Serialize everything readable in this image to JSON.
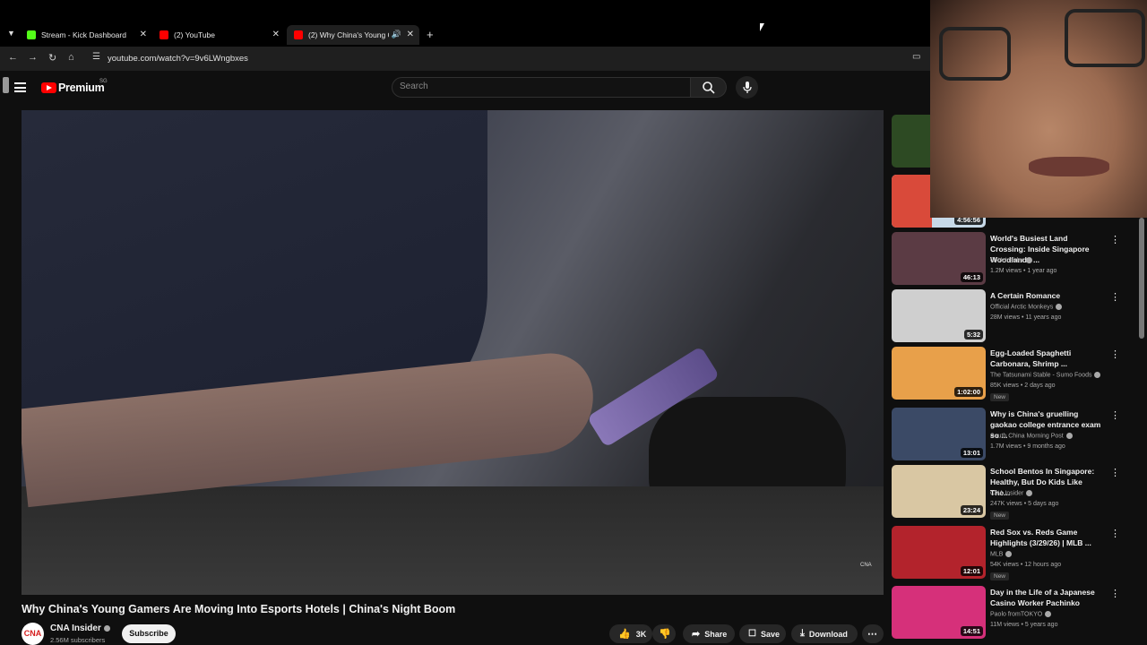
{
  "browser": {
    "tabs": [
      {
        "label": "Stream - Kick Dashboard",
        "icon": "kick-icon"
      },
      {
        "label": "(2) YouTube",
        "icon": "youtube-icon"
      },
      {
        "label": "(2) Why China's Young Gam",
        "icon": "youtube-icon",
        "active": true
      }
    ],
    "url": "youtube.com/watch?v=9v6LWngbxes"
  },
  "header": {
    "logo_text": "Premium",
    "country": "SG",
    "search_placeholder": "Search"
  },
  "video": {
    "title": "Why China's Young Gamers Are Moving Into Esports Hotels | China's Night Boom",
    "watermark": "CNA",
    "channel": "CNA Insider",
    "channel_avatar": "CNA",
    "subscribers": "2.56M subscribers",
    "subscribe_label": "Subscribe",
    "likes": "3K",
    "share_label": "Share",
    "save_label": "Save",
    "download_label": "Download"
  },
  "recommendations": [
    {
      "duration": "4:56:56"
    },
    {
      "title": "World's Busiest Land Crossing: Inside Singapore Woodlands ...",
      "channel": "CNA Insider",
      "meta": "1.2M views • 1 year ago",
      "duration": "46:13",
      "thumb_color": "#5b3b44"
    },
    {
      "title": "A Certain Romance",
      "channel": "Official Arctic Monkeys",
      "meta": "28M views • 11 years ago",
      "duration": "5:32",
      "thumb_color": "#cfcfcf"
    },
    {
      "title": "Egg-Loaded Spaghetti Carbonara, Shrimp ...",
      "channel": "The Tatsunami Stable - Sumo Foods",
      "meta": "85K views • 2 days ago",
      "badge": "New",
      "duration": "1:02:00",
      "thumb_color": "#e8a04a"
    },
    {
      "title": "Why is China's gruelling gaokao college entrance exam so ...",
      "channel": "South China Morning Post",
      "meta": "1.7M views • 9 months ago",
      "duration": "13:01",
      "thumb_color": "#3b4a66"
    },
    {
      "title": "School Bentos In Singapore: Healthy, But Do Kids Like The...",
      "channel": "CNA Insider",
      "meta": "247K views • 5 days ago",
      "badge": "New",
      "duration": "23:24",
      "thumb_color": "#d9c7a3"
    },
    {
      "title": "Red Sox vs. Reds Game Highlights (3/29/26) | MLB ...",
      "channel": "MLB",
      "meta": "54K views • 12 hours ago",
      "badge": "New",
      "duration": "12:01",
      "thumb_color": "#b3232c"
    },
    {
      "title": "Day in the Life of a Japanese Casino Worker Pachinko",
      "channel": "Paolo fromTOKYO",
      "meta": "11M views • 5 years ago",
      "duration": "14:51",
      "thumb_color": "#d6307a"
    }
  ]
}
